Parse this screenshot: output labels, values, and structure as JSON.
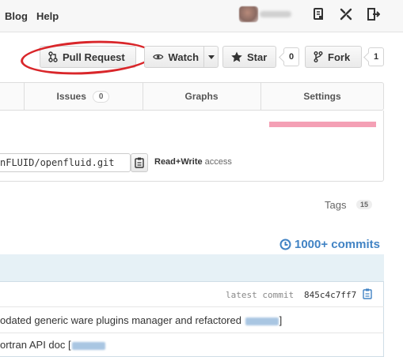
{
  "header": {
    "nav": [
      "Blog",
      "Help"
    ],
    "icons": [
      "notifications-icon",
      "settings-tools-icon",
      "sign-out-icon"
    ]
  },
  "actions": {
    "pull_request": "Pull Request",
    "watch": "Watch",
    "star": "Star",
    "star_count": "0",
    "fork": "Fork",
    "fork_count": "1"
  },
  "tabs": [
    {
      "label": "Issues",
      "badge": "0"
    },
    {
      "label": "Graphs"
    },
    {
      "label": "Settings"
    }
  ],
  "clone": {
    "url": "nFLUID/openfluid.git",
    "access_strong": "Read+Write",
    "access_rest": " access"
  },
  "tags": {
    "label": "Tags",
    "count": "15"
  },
  "commits": {
    "label": "1000+ commits"
  },
  "latest_commit": {
    "label": "latest commit",
    "sha": "845c4c7ff7"
  },
  "commit_messages": [
    "odated generic ware plugins manager and refactored",
    "ortran API doc"
  ],
  "colors": {
    "accent": "#4183c4",
    "highlight": "#d9262a",
    "pink": "#f4a0b5"
  }
}
